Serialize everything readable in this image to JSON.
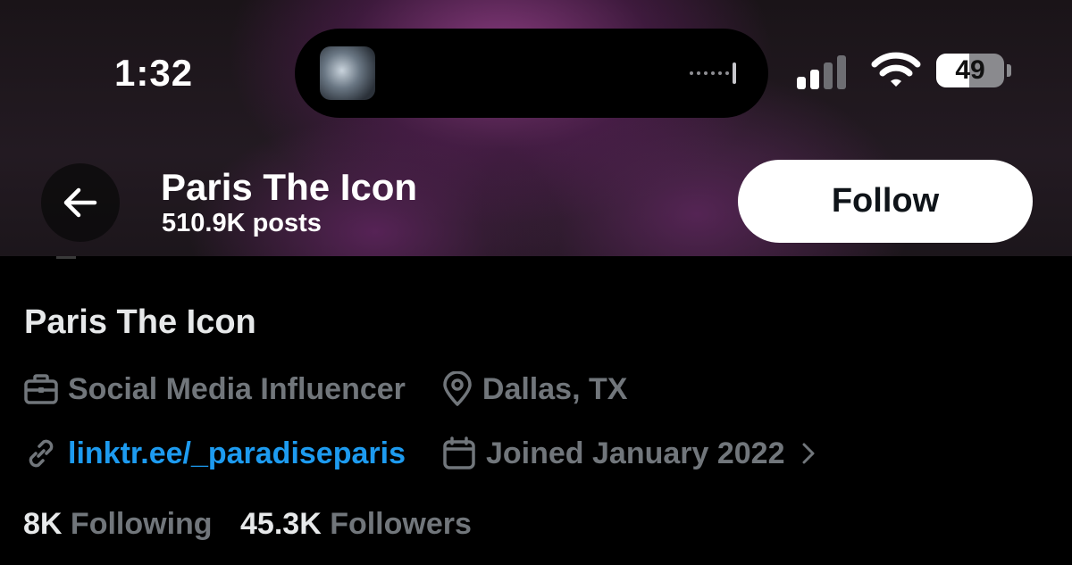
{
  "status_bar": {
    "time": "1:32",
    "battery": "49",
    "battery_level": 0.49
  },
  "header": {
    "display_name": "Paris The Icon",
    "posts_count": "510.9K posts",
    "follow_label": "Follow"
  },
  "profile": {
    "name": "Paris The Icon",
    "category": "Social Media Influencer",
    "location": "Dallas, TX",
    "link": "linktr.ee/_paradiseparis",
    "joined": "Joined January 2022",
    "following_count": "8K",
    "following_label": "Following",
    "followers_count": "45.3K",
    "followers_label": "Followers"
  },
  "colors": {
    "link": "#1d9bf0",
    "muted": "#71767b",
    "text": "#e7e9ea"
  },
  "icons": [
    "back-arrow-icon",
    "briefcase-icon",
    "location-pin-icon",
    "link-icon",
    "calendar-icon",
    "chevron-right-icon",
    "signal-icon",
    "wifi-icon",
    "battery-icon"
  ]
}
